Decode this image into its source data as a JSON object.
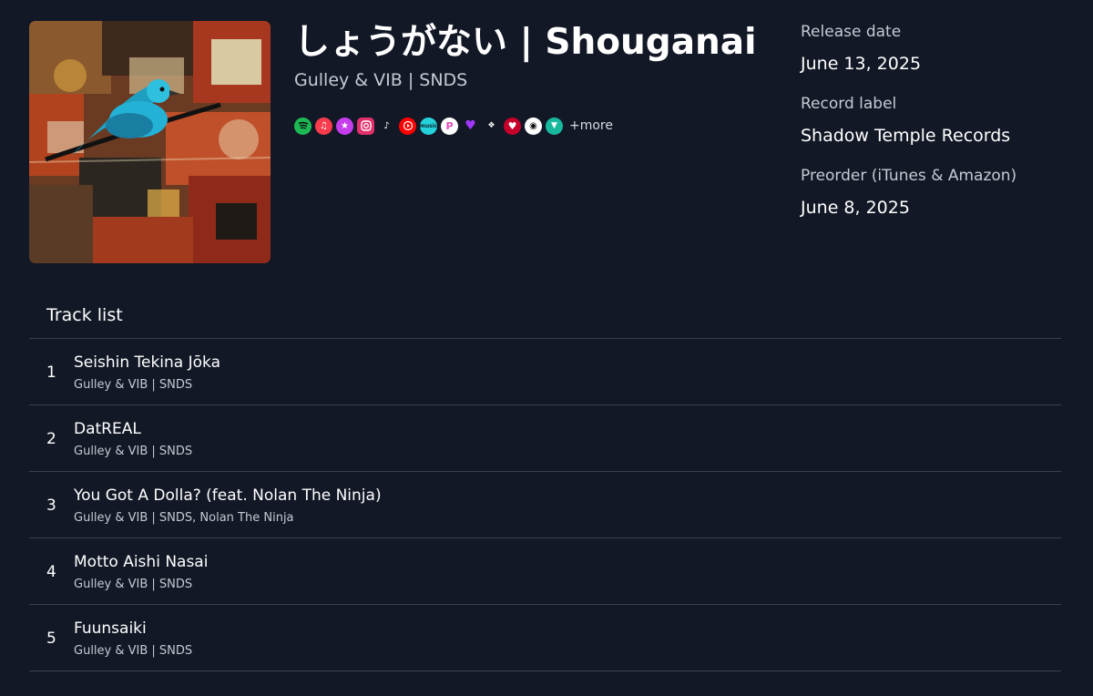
{
  "album": {
    "title": "しょうがない | Shouganai",
    "artist": "Gulley & VIB | SNDS",
    "cover_icon": "album-cover-blue-bird-collage"
  },
  "platforms": {
    "items": [
      {
        "name": "spotify",
        "icon": "spotify-icon",
        "color": "#1DB954"
      },
      {
        "name": "apple-music",
        "icon": "apple-music-icon",
        "color": "#FA3C4E"
      },
      {
        "name": "itunes-store",
        "icon": "itunes-star-icon",
        "color": "#C63DEB"
      },
      {
        "name": "instagram",
        "icon": "instagram-icon",
        "color": "#E1306C"
      },
      {
        "name": "tiktok",
        "icon": "tiktok-icon",
        "color": "#111111"
      },
      {
        "name": "youtube-music",
        "icon": "youtube-music-icon",
        "color": "#FF0000"
      },
      {
        "name": "amazon-music",
        "icon": "amazon-music-icon",
        "color": "#25D1DA"
      },
      {
        "name": "pandora",
        "icon": "pandora-icon",
        "color": "#FFFFFF"
      },
      {
        "name": "deezer",
        "icon": "deezer-heart-icon",
        "color": "#A238FF"
      },
      {
        "name": "tidal",
        "icon": "tidal-icon",
        "color": "#000000"
      },
      {
        "name": "iheartradio",
        "icon": "iheartradio-icon",
        "color": "#C6002B"
      },
      {
        "name": "napster",
        "icon": "napster-icon",
        "color": "#FFFFFF"
      },
      {
        "name": "audiomack",
        "icon": "audiomack-icon",
        "color": "#18B89E"
      }
    ],
    "more_label": "+more"
  },
  "meta": {
    "release_label": "Release date",
    "release_value": "June 13, 2025",
    "label_label": "Record label",
    "label_value": "Shadow Temple Records",
    "preorder_label": "Preorder (iTunes & Amazon)",
    "preorder_value": "June 8, 2025"
  },
  "tracklist": {
    "title": "Track list",
    "tracks": [
      {
        "number": "1",
        "title": "Seishin Tekina Jōka",
        "artist": "Gulley & VIB | SNDS"
      },
      {
        "number": "2",
        "title": "DatREAL",
        "artist": "Gulley & VIB | SNDS"
      },
      {
        "number": "3",
        "title": "You Got A Dolla? (feat. Nolan The Ninja)",
        "artist": "Gulley & VIB | SNDS, Nolan The Ninja"
      },
      {
        "number": "4",
        "title": "Motto Aishi Nasai",
        "artist": "Gulley & VIB | SNDS"
      },
      {
        "number": "5",
        "title": "Fuunsaiki",
        "artist": "Gulley & VIB | SNDS"
      }
    ]
  },
  "colors": {
    "background": "#121826",
    "divider": "#3a4150",
    "secondary_text": "#c5cad4"
  }
}
